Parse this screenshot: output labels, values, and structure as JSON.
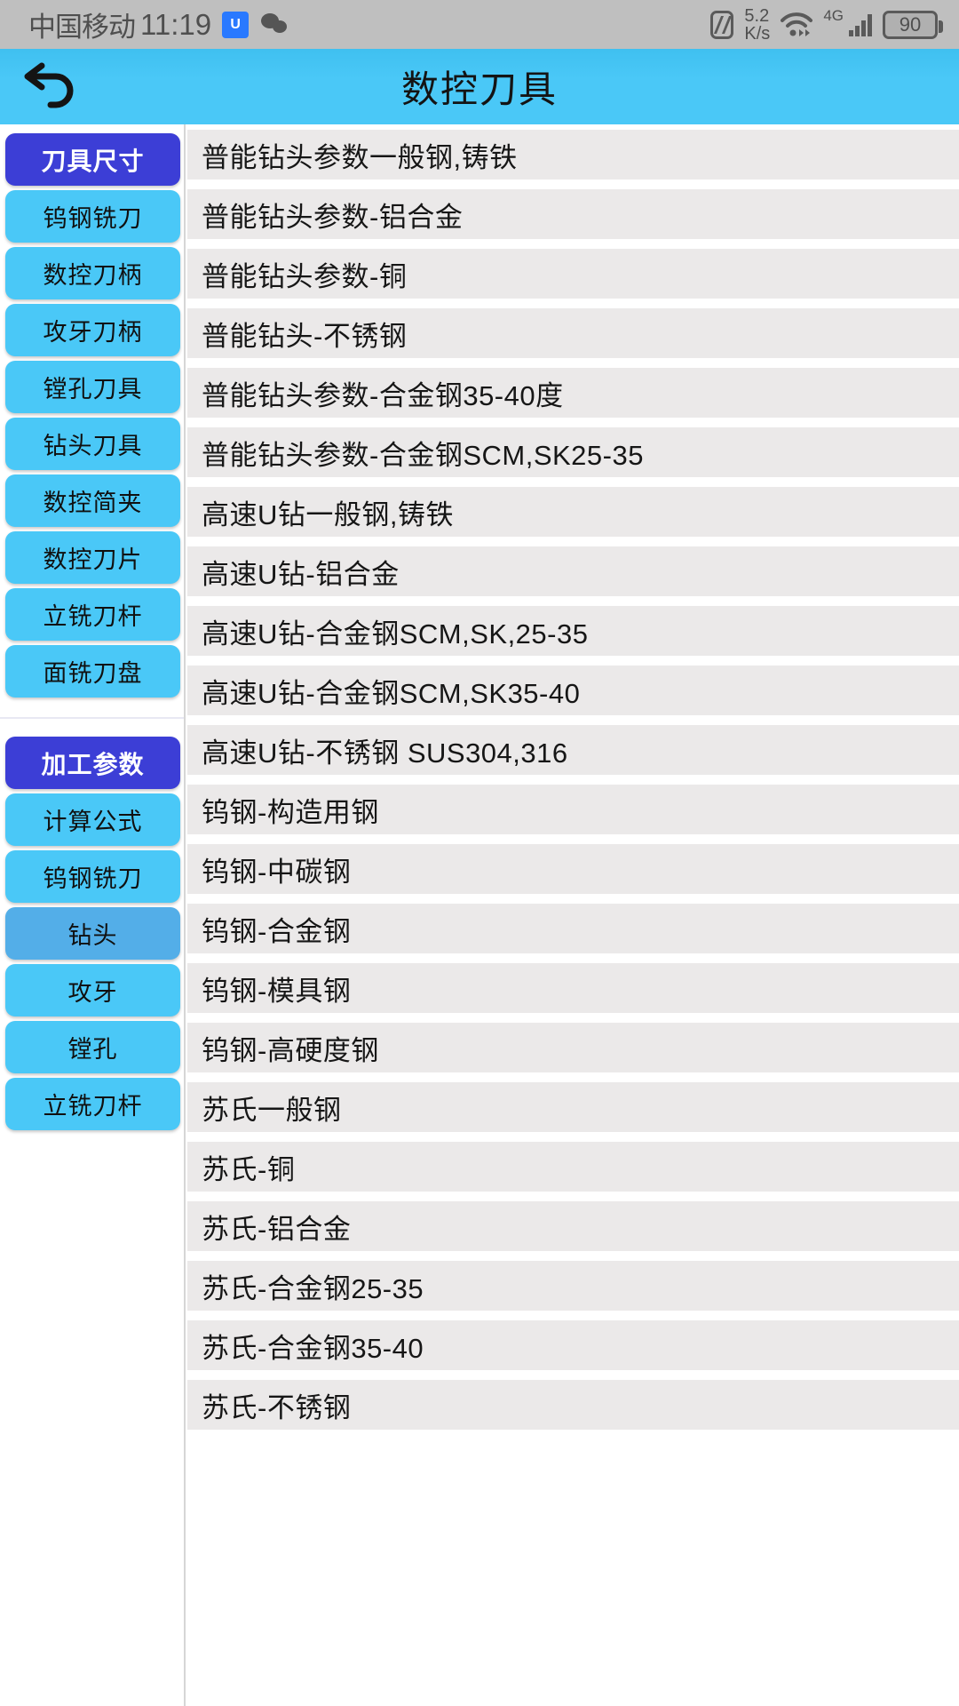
{
  "statusbar": {
    "carrier": "中国移动",
    "time": "11:19",
    "app_badge": "U",
    "app_badge_icon": "app-badge-icon",
    "wechat_icon": "wechat-icon",
    "nfc_icon": "nfc-icon",
    "network_speed": "5.2",
    "network_speed_unit": "K/s",
    "wifi_icon": "wifi-icon",
    "network_type": "4G",
    "signal_icon": "cellular-signal-icon",
    "battery_level": "90"
  },
  "header": {
    "back_icon": "back-arrow-icon",
    "title": "数控刀具",
    "bg_color": "#4ac8f7"
  },
  "sidebar": {
    "group1": [
      {
        "label": "刀具尺寸",
        "state": "primary"
      },
      {
        "label": "钨钢铣刀",
        "state": "normal"
      },
      {
        "label": "数控刀柄",
        "state": "normal"
      },
      {
        "label": "攻牙刀柄",
        "state": "normal"
      },
      {
        "label": "镗孔刀具",
        "state": "normal"
      },
      {
        "label": "钻头刀具",
        "state": "normal"
      },
      {
        "label": "数控简夹",
        "state": "normal"
      },
      {
        "label": "数控刀片",
        "state": "normal"
      },
      {
        "label": "立铣刀杆",
        "state": "normal"
      },
      {
        "label": "面铣刀盘",
        "state": "normal"
      }
    ],
    "group2": [
      {
        "label": "加工参数",
        "state": "primary"
      },
      {
        "label": "计算公式",
        "state": "normal"
      },
      {
        "label": "钨钢铣刀",
        "state": "normal"
      },
      {
        "label": "钻头",
        "state": "pressed"
      },
      {
        "label": "攻牙",
        "state": "normal"
      },
      {
        "label": "镗孔",
        "state": "normal"
      },
      {
        "label": "立铣刀杆",
        "state": "normal"
      }
    ],
    "accent_color": "#4ac8f7",
    "primary_color": "#3c3ed6",
    "pressed_color": "#53aee8"
  },
  "list": {
    "rows": [
      "普能钻头参数一般钢,铸铁",
      "普能钻头参数-铝合金",
      "普能钻头参数-铜",
      "普能钻头-不锈钢",
      "普能钻头参数-合金钢35-40度",
      "普能钻头参数-合金钢SCM,SK25-35",
      "高速U钻一般钢,铸铁",
      "高速U钻-铝合金",
      "高速U钻-合金钢SCM,SK,25-35",
      "高速U钻-合金钢SCM,SK35-40",
      "高速U钻-不锈钢 SUS304,316",
      "钨钢-构造用钢",
      "钨钢-中碳钢",
      "钨钢-合金钢",
      "钨钢-模具钢",
      "钨钢-高硬度钢",
      "苏氏一般钢",
      "苏氏-铜",
      "苏氏-铝合金",
      "苏氏-合金钢25-35",
      "苏氏-合金钢35-40",
      "苏氏-不锈钢"
    ],
    "row_bg": "#ebe9e9"
  }
}
